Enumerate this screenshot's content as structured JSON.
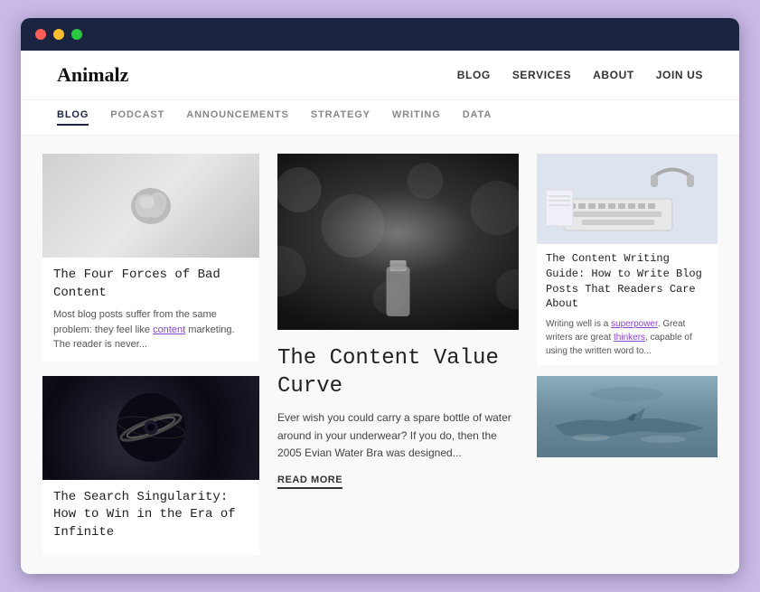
{
  "browser": {
    "dots": [
      "red",
      "yellow",
      "green"
    ]
  },
  "header": {
    "logo": "Animalz",
    "nav": [
      {
        "label": "BLOG",
        "active": false
      },
      {
        "label": "SERVICES",
        "active": false
      },
      {
        "label": "ABOUT",
        "active": false
      },
      {
        "label": "JOIN US",
        "active": false
      }
    ],
    "subnav": [
      {
        "label": "BLOG",
        "active": true
      },
      {
        "label": "PODCAST",
        "active": false
      },
      {
        "label": "ANNOUNCEMENTS",
        "active": false
      },
      {
        "label": "STRATEGY",
        "active": false
      },
      {
        "label": "WRITING",
        "active": false
      },
      {
        "label": "DATA",
        "active": false
      }
    ]
  },
  "left_cards": [
    {
      "id": "four-forces",
      "title": "The Four Forces of Bad Content",
      "desc": "Most blog posts suffer from the same problem: they feel like content marketing. The reader is never...",
      "desc_highlight_start": 49,
      "desc_highlight_word": "content"
    },
    {
      "id": "search-singularity",
      "title": "The Search Singularity: How to Win in the Era of Infinite",
      "desc": ""
    }
  ],
  "featured": {
    "title": "The Content Value Curve",
    "desc": "Ever wish you could carry a spare bottle of water around in your underwear? If you do, then the 2005 Evian Water Bra was designed...",
    "read_more": "READ MORE"
  },
  "right_cards": [
    {
      "id": "content-writing-guide",
      "title": "The Content Writing Guide: How to Write Blog Posts That Readers Care About",
      "desc": "Writing well is a superpower. Great writers are great thinkers, capable of using the written word to...",
      "desc_highlight": "superpower"
    },
    {
      "id": "shark-article",
      "title": "",
      "desc": ""
    }
  ],
  "colors": {
    "background": "#c9b8e8",
    "nav_bg": "#1a2340",
    "accent": "#8844cc",
    "text_dark": "#222222",
    "text_mid": "#555555",
    "text_light": "#888888"
  }
}
